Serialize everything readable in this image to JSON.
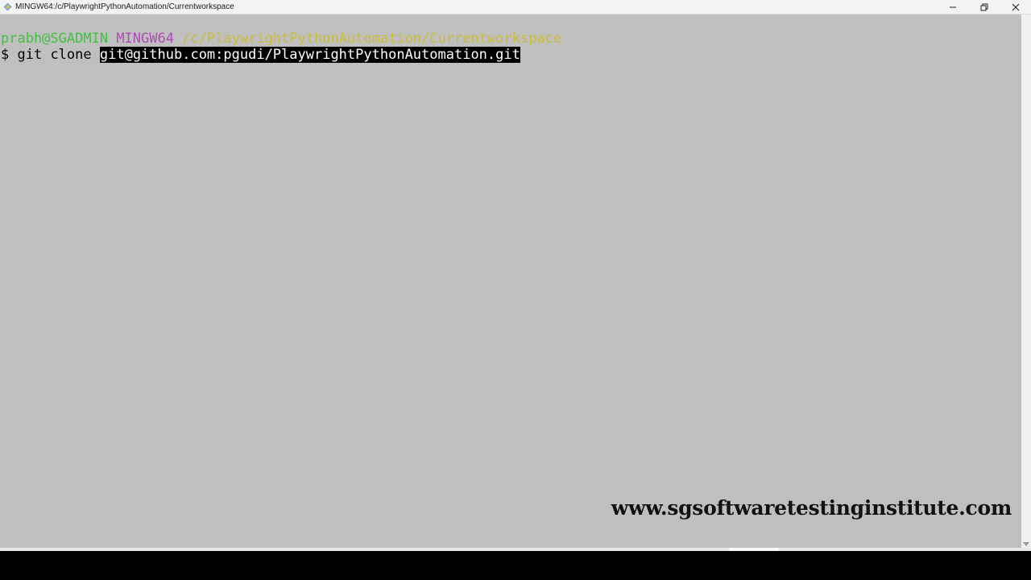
{
  "window": {
    "title": "MINGW64:/c/PlaywrightPythonAutomation/Currentworkspace",
    "controls": {
      "minimize_icon": "minimize-icon",
      "restore_icon": "restore-icon",
      "close_icon": "close-icon"
    }
  },
  "terminal": {
    "prompt": {
      "user_host": "prabh@SGADMIN",
      "shell": "MINGW64",
      "path": "/c/PlaywrightPythonAutomation/Currentworkspace"
    },
    "command": {
      "symbol": "$",
      "text": "git clone",
      "selected_arg": "git@github.com:pgudi/PlaywrightPythonAutomation.git"
    }
  },
  "watermark": "www.sgsoftwaretestinginstitute.com",
  "colors": {
    "background": "#bfbfbf",
    "user_host": "#44c044",
    "shell": "#b04bb8",
    "path": "#c9bf3a",
    "selection_bg": "#000000",
    "selection_fg": "#ffffff"
  }
}
